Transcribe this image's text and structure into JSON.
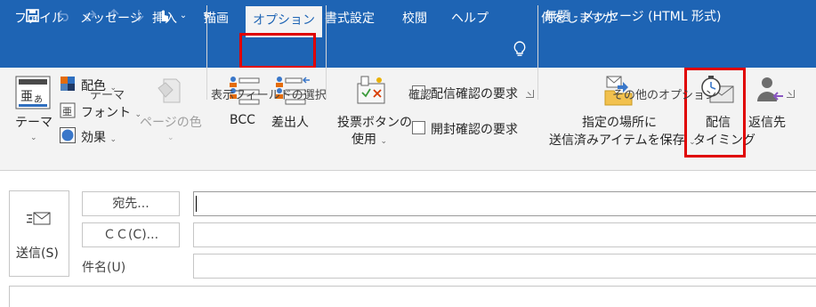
{
  "window": {
    "title": "無題 - メッセージ (HTML 形式)"
  },
  "qat": {
    "save_icon": "save-icon",
    "undo_icon": "undo-icon",
    "redo_icon": "redo-icon",
    "up_icon": "arrow-up-icon",
    "down_icon": "arrow-down-icon",
    "touch_icon": "touch-mode-icon",
    "customize_icon": "customize-qat-icon"
  },
  "tabs": [
    {
      "label": "ファイル"
    },
    {
      "label": "メッセージ"
    },
    {
      "label": "挿入"
    },
    {
      "label": "描画"
    },
    {
      "label": "オプション"
    },
    {
      "label": "書式設定"
    },
    {
      "label": "校閲"
    },
    {
      "label": "ヘルプ"
    }
  ],
  "tellme": "何をしますか",
  "ribbon": {
    "theme": {
      "theme_label": "テーマ",
      "colors_label": "配色",
      "fonts_label": "フォント",
      "effects_label": "効果",
      "page_color_label": "ページの色",
      "group_label": "テーマ"
    },
    "show_fields": {
      "bcc_label": "BCC",
      "from_label": "差出人",
      "group_label": "表示フィールドの選択"
    },
    "tracking": {
      "voting_label_1": "投票ボタンの",
      "voting_label_2": "使用",
      "delivery_receipt_label": "配信確認の要求",
      "read_receipt_label": "開封確認の要求",
      "group_label": "確認"
    },
    "more_options": {
      "save_sent_label_1": "指定の場所に",
      "save_sent_label_2": "送信済みアイテムを保存",
      "delay_label_1": "配信",
      "delay_label_2": "タイミング",
      "reply_to_label": "返信先",
      "group_label": "その他のオプション"
    }
  },
  "compose": {
    "send_label": "送信(S)",
    "to_label": "宛先...",
    "cc_label": "ＣＣ(C)...",
    "subject_label": "件名(U)",
    "to_value": "",
    "cc_value": "",
    "subject_value": ""
  },
  "colors": {
    "titlebar": "#1e64b4",
    "ribbon": "#f3f3f3",
    "highlight": "#e00000"
  }
}
